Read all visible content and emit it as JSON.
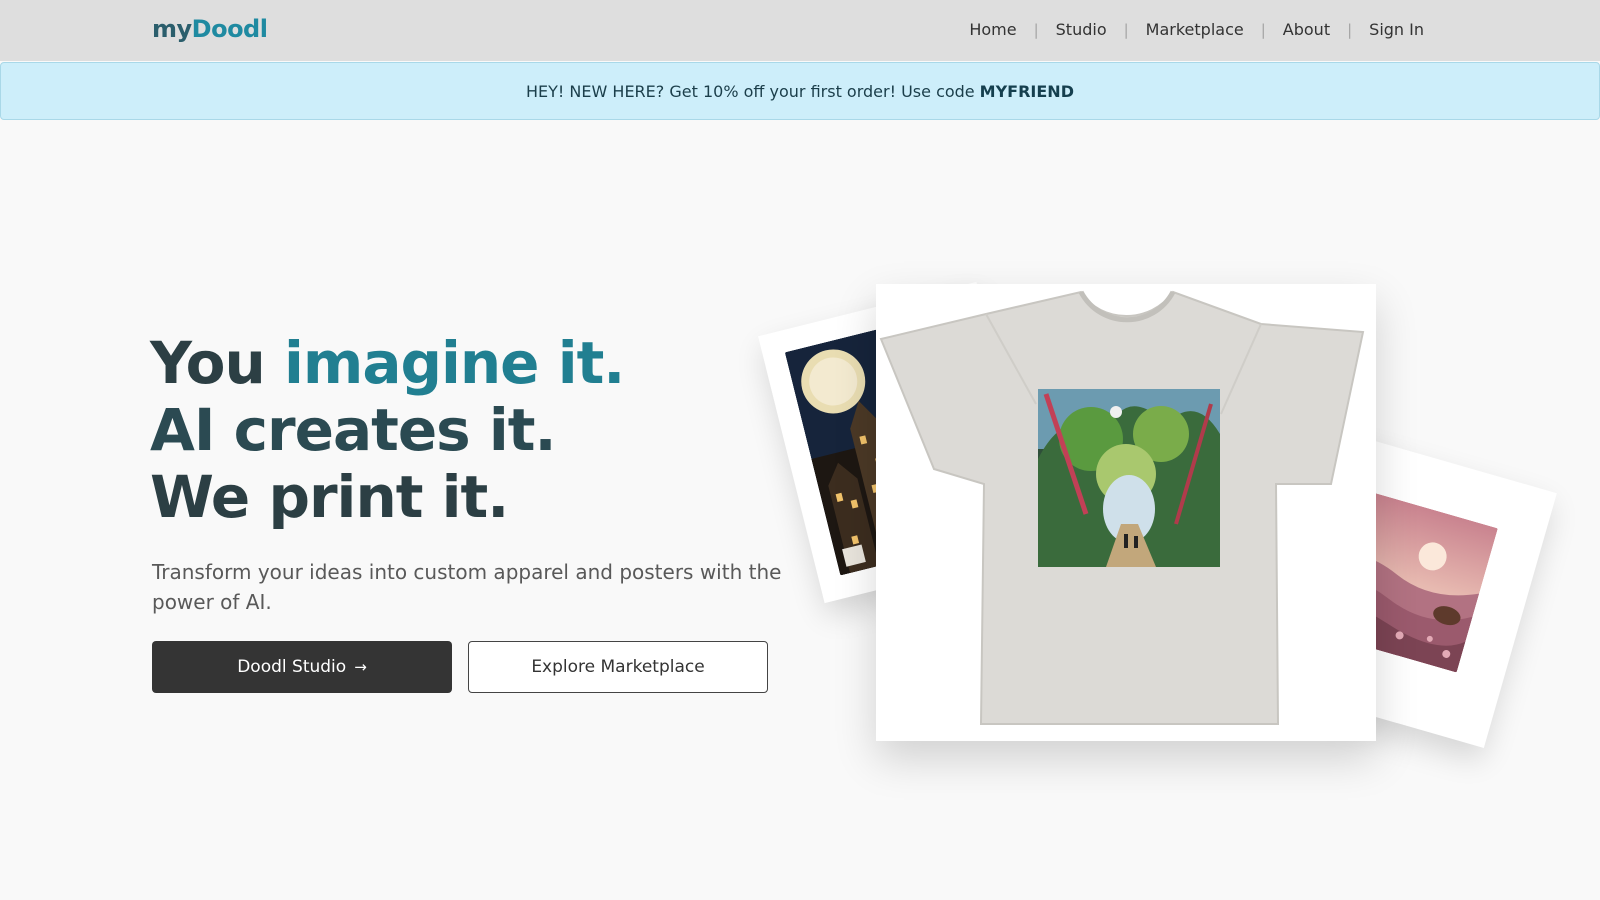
{
  "nav": {
    "brand_prefix": "my",
    "brand_suffix": "Doodl",
    "links": [
      {
        "label": "Home"
      },
      {
        "label": "Studio"
      },
      {
        "label": "Marketplace"
      },
      {
        "label": "About"
      },
      {
        "label": "Sign In"
      }
    ],
    "separator": "|"
  },
  "promo": {
    "text": "HEY! NEW HERE? Get 10% off your first order! Use code",
    "code": "MYFRIEND"
  },
  "hero": {
    "line1_a": "You",
    "line1_b": "imagine it.",
    "line2": "AI creates it.",
    "line3": "We print it.",
    "subtitle": "Transform your ideas into custom apparel and posters with the power of AI.",
    "primary_button": "Doodl Studio",
    "primary_arrow": "→",
    "secondary_button": "Explore Marketplace"
  },
  "colors": {
    "accent": "#217f91",
    "brand_dark": "#2b5e6c",
    "promo_bg": "#cdeefa",
    "nav_bg": "#dedede",
    "button_dark": "#343434"
  },
  "showcase": {
    "items": [
      "poster-city-art",
      "tshirt-forest-print",
      "poster-landscape-art"
    ]
  }
}
